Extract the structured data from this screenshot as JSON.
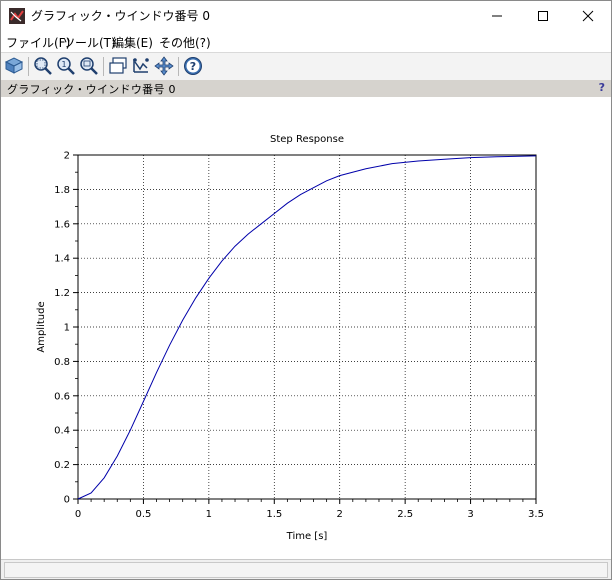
{
  "window": {
    "title": "グラフィック・ウインドウ番号 0"
  },
  "menu": {
    "items": [
      {
        "label": "ファイル(F)",
        "name": "menu-file"
      },
      {
        "label": "ツール(T)",
        "name": "menu-tools"
      },
      {
        "label": "編集(E)",
        "name": "menu-edit"
      },
      {
        "label": "その他(?)",
        "name": "menu-other"
      }
    ]
  },
  "toolbar": {
    "icons": [
      "rotate-icon",
      "zoom-in-icon",
      "zoom-original-icon",
      "zoom-out-icon",
      "datatip-icon",
      "edit-axes-icon",
      "pan-icon",
      "help-icon"
    ]
  },
  "docbar": {
    "title": "グラフィック・ウインドウ番号 0",
    "help_label": "?"
  },
  "chart_data": {
    "type": "line",
    "title": "Step Response",
    "xlabel": "Time [s]",
    "ylabel": "Amplitude",
    "xlim": [
      0,
      3.5
    ],
    "ylim": [
      0,
      2
    ],
    "grid": true,
    "line_color": "#0000aa",
    "x_ticks": [
      "0",
      "0.5",
      "1",
      "1.5",
      "2",
      "2.5",
      "3",
      "3.5"
    ],
    "y_ticks": [
      "0",
      "0.2",
      "0.4",
      "0.6",
      "0.8",
      "1",
      "1.2",
      "1.4",
      "1.6",
      "1.8",
      "2"
    ],
    "series": [
      {
        "x": [
          0,
          0.1,
          0.2,
          0.3,
          0.4,
          0.5,
          0.6,
          0.7,
          0.8,
          0.9,
          1.0,
          1.1,
          1.2,
          1.3,
          1.4,
          1.5,
          1.6,
          1.7,
          1.8,
          1.9,
          2.0,
          2.2,
          2.4,
          2.6,
          2.8,
          3.0,
          3.2,
          3.5
        ],
        "values": [
          0,
          0.035,
          0.123,
          0.25,
          0.4,
          0.567,
          0.735,
          0.894,
          1.04,
          1.17,
          1.284,
          1.383,
          1.47,
          1.54,
          1.6,
          1.66,
          1.72,
          1.77,
          1.81,
          1.85,
          1.88,
          1.92,
          1.95,
          1.965,
          1.975,
          1.985,
          1.99,
          1.995
        ]
      }
    ]
  }
}
